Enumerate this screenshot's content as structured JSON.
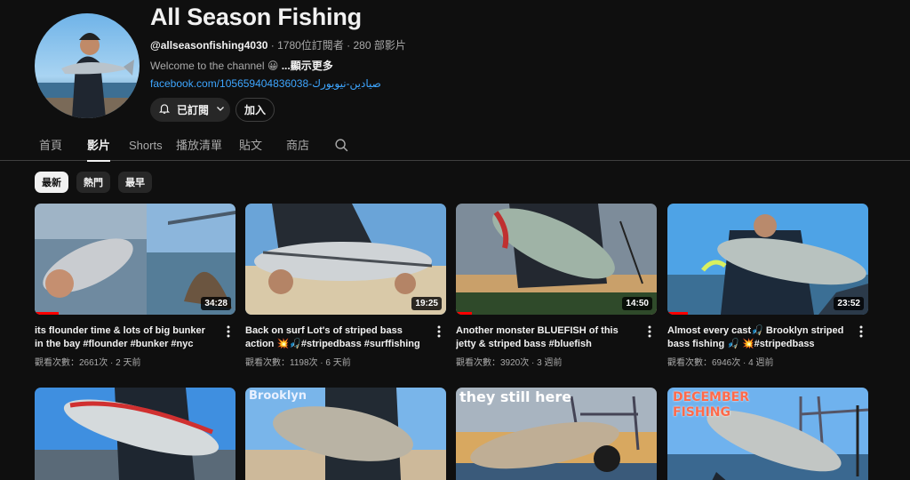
{
  "channel": {
    "name": "All Season Fishing",
    "handle": "@allseasonfishing4030",
    "subscribers": "1780位訂閱者",
    "video_count": "280 部影片",
    "description": "Welcome to the channel 😀",
    "show_more": "...顯示更多",
    "link": "facebook.com/105659404836038-صيادين-نيويورك",
    "subscribed_label": "已訂閱",
    "join_label": "加入"
  },
  "tabs": [
    "首頁",
    "影片",
    "Shorts",
    "播放清單",
    "貼文",
    "商店"
  ],
  "active_tab": "影片",
  "chips": [
    "最新",
    "熱門",
    "最早"
  ],
  "active_chip": "最新",
  "videos": [
    {
      "title": "its flounder time & lots of big bunker in the bay #flounder #bunker #nyc",
      "views": "觀看次數：2661次",
      "age": "2 天前",
      "duration": "34:28",
      "watched": 0.12
    },
    {
      "title": "Back on surf Lot's of striped bass action 💥🎣#stripedbass #surffishing #brooklyn",
      "views": "觀看次數：1198次",
      "age": "6 天前",
      "duration": "19:25",
      "watched": 0
    },
    {
      "title": "Another monster BLUEFISH of this jetty & striped bass #bluefish #stripedbass...",
      "views": "觀看次數：3920次",
      "age": "3 週前",
      "duration": "14:50",
      "watched": 0.08
    },
    {
      "title": "Almost every cast🎣 Brooklyn striped bass fishing 🎣 💥#stripedbass #surffishing...",
      "views": "觀看次數：6946次",
      "age": "4 週前",
      "duration": "23:52",
      "watched": 0.1
    },
    {
      "title": "",
      "views": "",
      "age": "",
      "duration": "",
      "watched": 0
    },
    {
      "title": "",
      "views": "",
      "age": "",
      "duration": "",
      "watched": 0,
      "overlay": "Brooklyn"
    },
    {
      "title": "",
      "views": "",
      "age": "",
      "duration": "",
      "watched": 0,
      "overlay": "they still here"
    },
    {
      "title": "",
      "views": "",
      "age": "",
      "duration": "",
      "watched": 0,
      "overlay": "DECEMBER FISHING"
    }
  ],
  "colors": {
    "accent": "#3ea6ff",
    "progress": "#ff0000",
    "background": "#0f0f0f"
  },
  "icons": {
    "bell": "bell-icon",
    "chevron": "chevron-down-icon",
    "search": "search-icon",
    "menu": "more-vert-icon"
  }
}
